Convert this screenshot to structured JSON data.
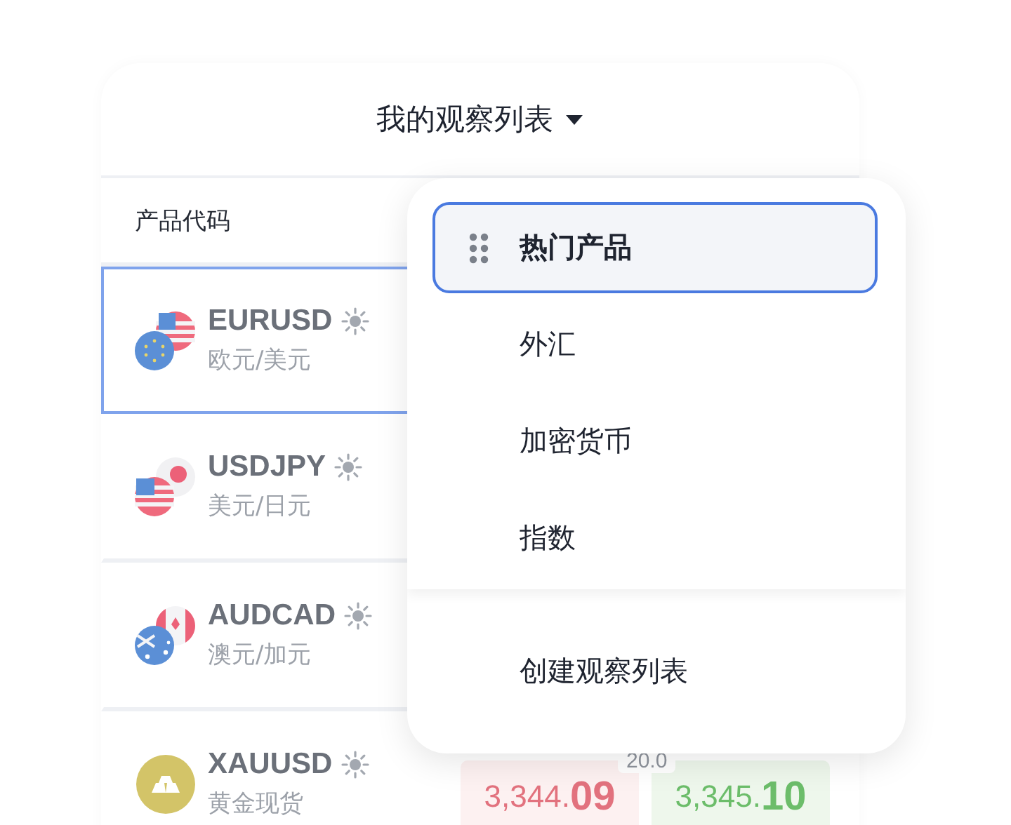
{
  "header": {
    "title": "我的观察列表"
  },
  "table": {
    "column_header": "产品代码",
    "rows": [
      {
        "symbol": "EURUSD",
        "name": "欧元/美元",
        "selected": true
      },
      {
        "symbol": "USDJPY",
        "name": "美元/日元",
        "selected": false
      },
      {
        "symbol": "AUDCAD",
        "name": "澳元/加元",
        "selected": false
      },
      {
        "symbol": "XAUUSD",
        "name": "黄金现货",
        "selected": false,
        "bid": {
          "main": "3,344.",
          "pips": "09"
        },
        "ask": {
          "main": "3,345.",
          "pips": "10"
        },
        "spread": "20.0"
      }
    ]
  },
  "menu": {
    "items": [
      {
        "label": "热门产品",
        "selected": true
      },
      {
        "label": "外汇",
        "selected": false
      },
      {
        "label": "加密货币",
        "selected": false
      },
      {
        "label": "指数",
        "selected": false
      }
    ],
    "footer": "创建观察列表"
  }
}
